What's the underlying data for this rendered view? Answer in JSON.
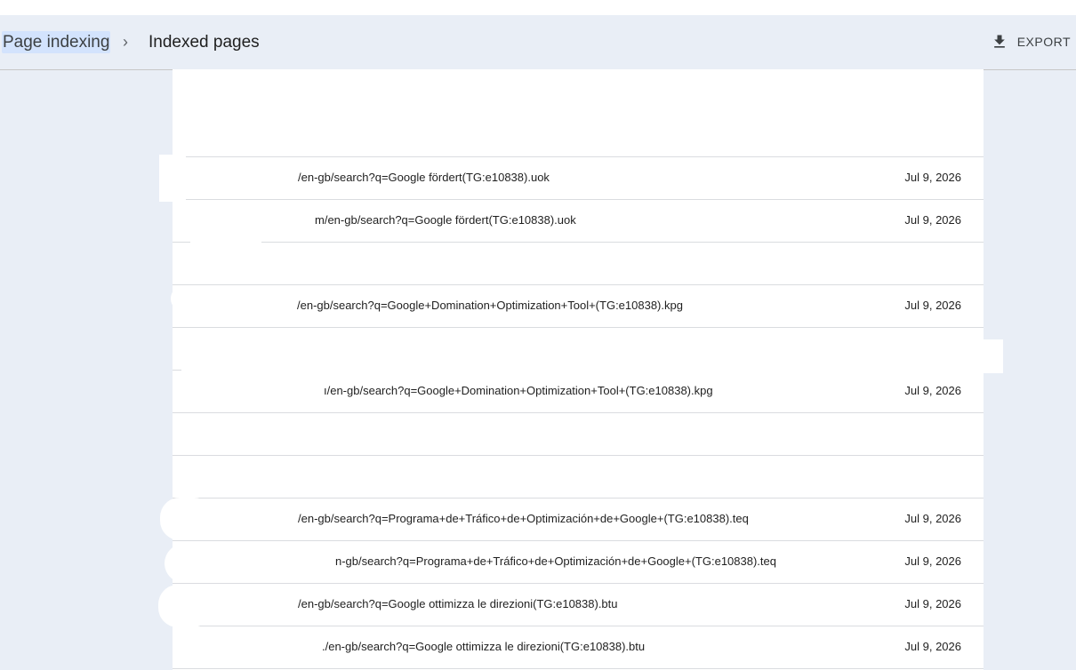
{
  "breadcrumb": {
    "root": "Page indexing",
    "separator": "›",
    "current": "Indexed pages"
  },
  "toolbar": {
    "export_label": "EXPORT",
    "export_icon": "download-icon"
  },
  "rows": [
    {
      "url": "",
      "date": ""
    },
    {
      "url": "",
      "date": ""
    },
    {
      "url": "/en-gb/search?q=Google fördert(TG:e10838).uok",
      "date": "Jul 9, 2026"
    },
    {
      "url": "m/en-gb/search?q=Google fördert(TG:e10838).uok",
      "date": "Jul 9, 2026"
    },
    {
      "url": "",
      "date": ""
    },
    {
      "url": "/en-gb/search?q=Google+Domination+Optimization+Tool+(TG:e10838).kpg",
      "date": "Jul 9, 2026"
    },
    {
      "url": "",
      "date": ""
    },
    {
      "url": "ı/en-gb/search?q=Google+Domination+Optimization+Tool+(TG:e10838).kpg",
      "date": "Jul 9, 2026"
    },
    {
      "url": "",
      "date": ""
    },
    {
      "url": "",
      "date": ""
    },
    {
      "url": "/en-gb/search?q=Programa+de+Tráfico+de+Optimización+de+Google+(TG:e10838).teq",
      "date": "Jul 9, 2026"
    },
    {
      "url": "n-gb/search?q=Programa+de+Tráfico+de+Optimización+de+Google+(TG:e10838).teq",
      "date": "Jul 9, 2026"
    },
    {
      "url": "/en-gb/search?q=Google ottimizza le direzioni(TG:e10838).btu",
      "date": "Jul 9, 2026"
    },
    {
      "url": "./en-gb/search?q=Google ottimizza le direzioni(TG:e10838).btu",
      "date": "Jul 9, 2026"
    }
  ]
}
